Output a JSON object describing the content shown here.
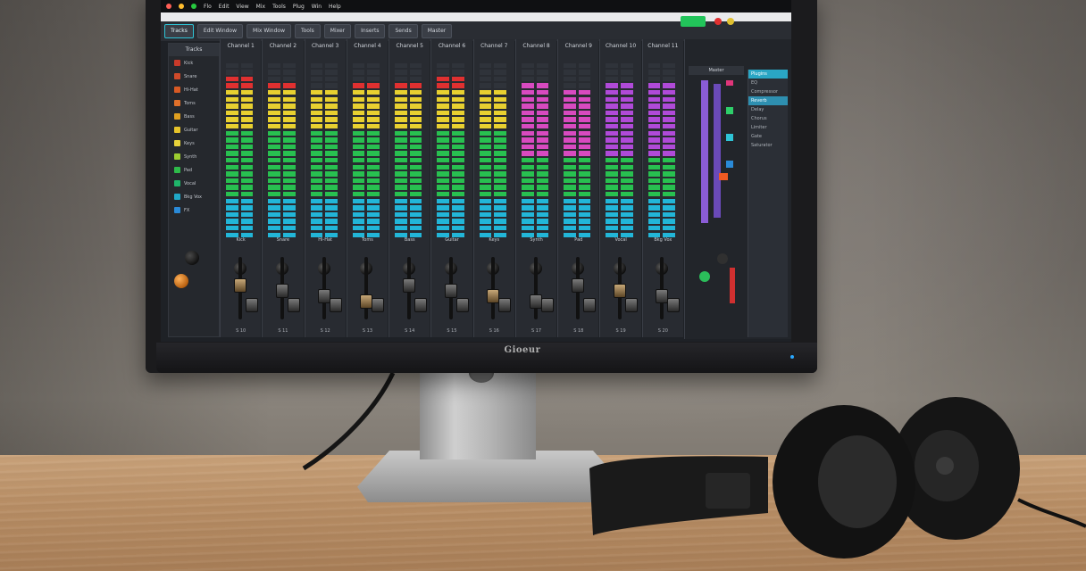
{
  "scene": {
    "monitor_brand": "Gioeur"
  },
  "daw": {
    "menu": [
      "Flo",
      "Edit",
      "View",
      "Mix",
      "Tools",
      "Plug",
      "Win",
      "Help"
    ],
    "toolbar": [
      "Tracks",
      "Edit Window",
      "Mix Window",
      "Tools",
      "Mixer",
      "Inserts",
      "Sends",
      "Master"
    ],
    "tracklist_title": "Tracks",
    "tracks": [
      {
        "name": "Kick",
        "color": "#c83a2a"
      },
      {
        "name": "Snare",
        "color": "#d04a2a"
      },
      {
        "name": "Hi-Hat",
        "color": "#d85a24"
      },
      {
        "name": "Toms",
        "color": "#e0702a"
      },
      {
        "name": "Bass",
        "color": "#e0a020"
      },
      {
        "name": "Guitar",
        "color": "#e6c32a"
      },
      {
        "name": "Keys",
        "color": "#e8d23a"
      },
      {
        "name": "Synth",
        "color": "#9ccc30"
      },
      {
        "name": "Pad",
        "color": "#2ebb4a"
      },
      {
        "name": "Vocal",
        "color": "#1fb56a"
      },
      {
        "name": "Bkg Vox",
        "color": "#20a8c8"
      },
      {
        "name": "FX",
        "color": "#2a8ad8"
      }
    ],
    "channels": [
      {
        "title": "Channel 1",
        "label": "Kick",
        "foot": "S 10",
        "level": 0.92
      },
      {
        "title": "Channel 2",
        "label": "Snare",
        "foot": "S 11",
        "level": 0.88
      },
      {
        "title": "Channel 3",
        "label": "Hi-Hat",
        "foot": "S 12",
        "level": 0.85
      },
      {
        "title": "Channel 4",
        "label": "Toms",
        "foot": "S 13",
        "level": 0.9
      },
      {
        "title": "Channel 5",
        "label": "Bass",
        "foot": "S 14",
        "level": 0.87
      },
      {
        "title": "Channel 6",
        "label": "Guitar",
        "foot": "S 15",
        "level": 0.91
      },
      {
        "title": "Channel 7",
        "label": "Keys",
        "foot": "S 16",
        "level": 0.86
      },
      {
        "title": "Channel 8",
        "label": "Synth",
        "foot": "S 17",
        "level": 0.89
      },
      {
        "title": "Channel 9",
        "label": "Pad",
        "foot": "S 18",
        "level": 0.84
      },
      {
        "title": "Channel 10",
        "label": "Vocal",
        "foot": "S 19",
        "level": 0.9
      },
      {
        "title": "Channel 11",
        "label": "Bkg Vox",
        "foot": "S 20",
        "level": 0.88
      }
    ],
    "rightpanel_title": "Master",
    "browser": [
      "Plugins",
      "EQ",
      "Compressor",
      "Reverb",
      "Delay",
      "Chorus",
      "Limiter",
      "Gate",
      "Saturator"
    ],
    "colors": {
      "meter_top": "#e03030",
      "meter_mid": "#e8d030",
      "meter_low": "#28c050",
      "meter_base": "#22b6d8",
      "accent": "#2ec4d6"
    }
  }
}
